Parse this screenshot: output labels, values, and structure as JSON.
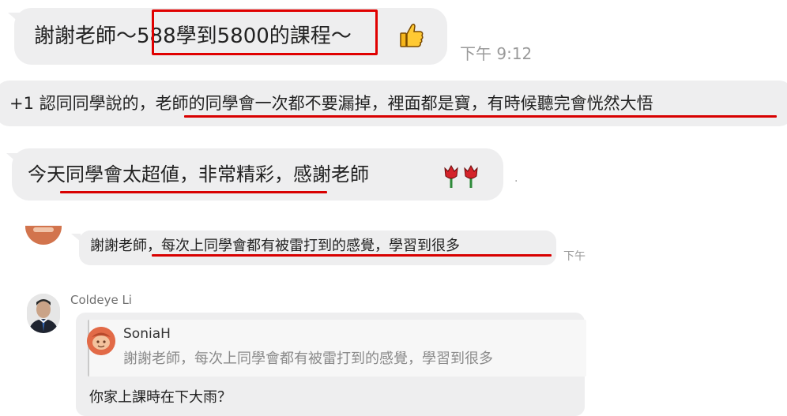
{
  "messages": {
    "m1": {
      "before": "謝謝老師～",
      "highlight": "588學到5800的課程",
      "after": "～",
      "emoji": "thumbs-up",
      "time": "下午 9:12"
    },
    "m2": {
      "text": "+1  認同同學說的，老師的同學會一次都不要漏掉，裡面都是寶，有時候聽完會恍然大悟"
    },
    "m3": {
      "text": "今天同學會太超値，非常精彩，感謝老師",
      "emoji": "tulips"
    },
    "m4": {
      "text": "謝謝老師，每次上同學會都有被雷打到的感覺，學習到很多",
      "time": "下午"
    },
    "m5": {
      "sender": "Coldeye Li",
      "quote": {
        "sender": "SoniaH",
        "text": "謝謝老師，每次上同學會都有被雷打到的感覺，學習到很多"
      },
      "text": "你家上課時在下大雨？"
    }
  },
  "colors": {
    "bubble": "#eeeeef",
    "highlight": "#e00000",
    "time": "#9a9a9a"
  }
}
